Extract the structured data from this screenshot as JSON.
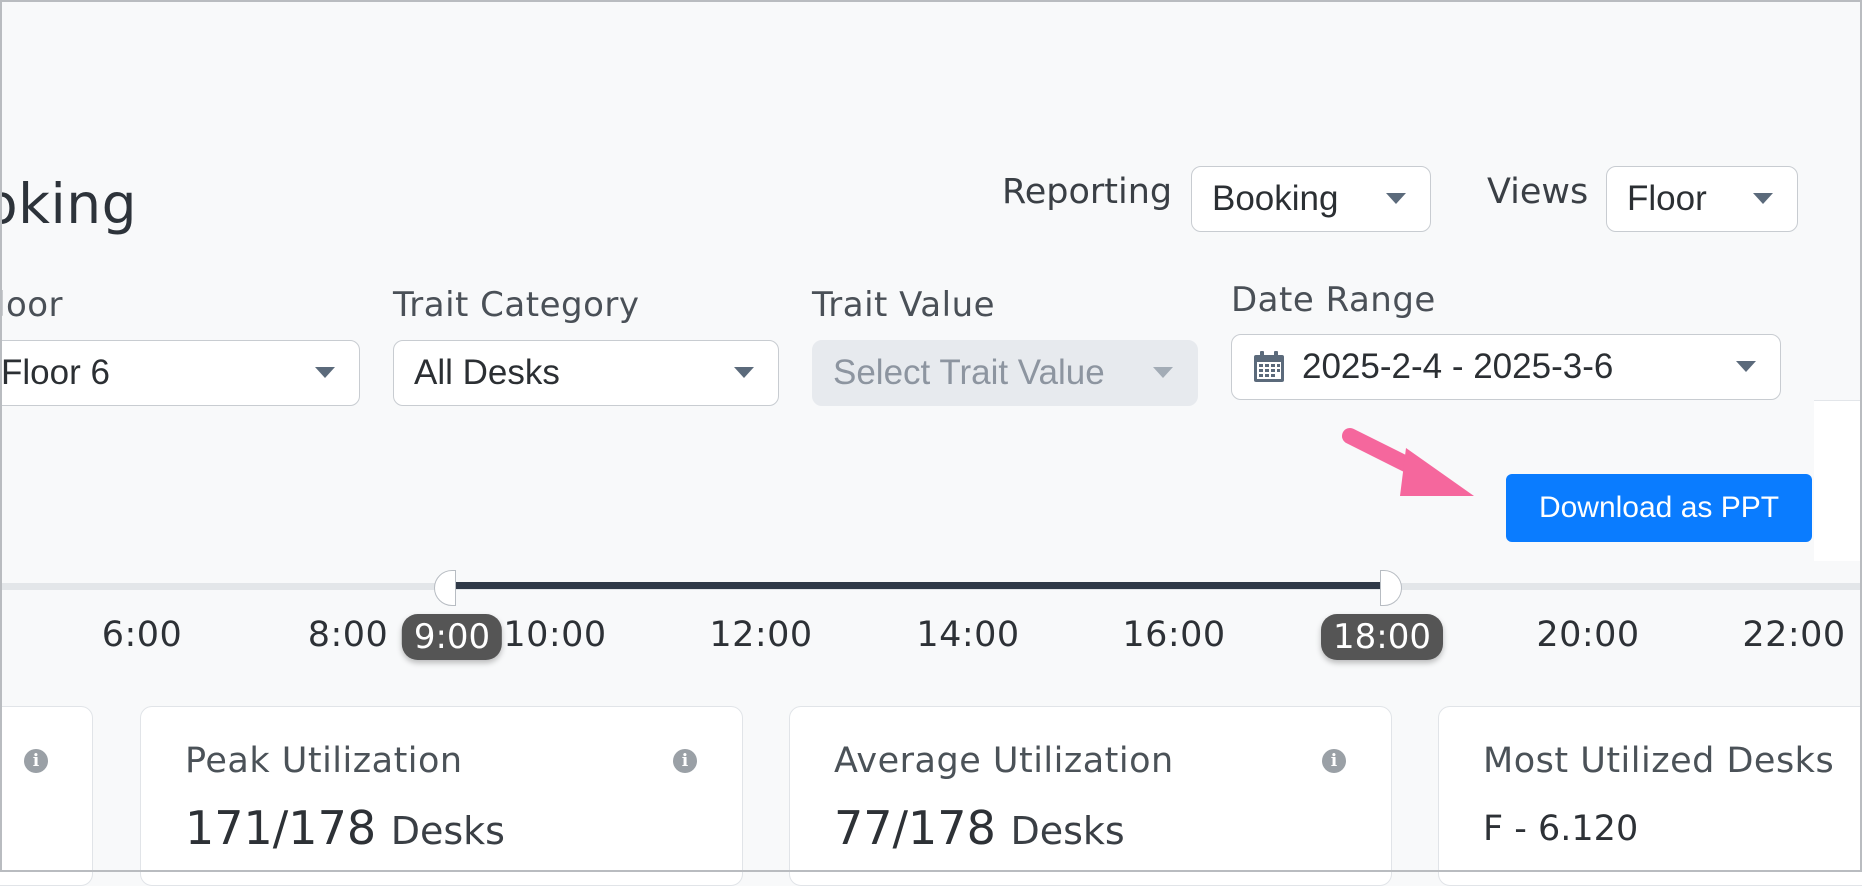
{
  "header": {
    "title": "oking",
    "reporting_label": "Reporting",
    "reporting_value": "Booking",
    "views_label": "Views",
    "views_value": "Floor"
  },
  "filters": {
    "floor": {
      "label": "loor",
      "value": "Floor 6"
    },
    "trait_category": {
      "label": "Trait Category",
      "value": "All Desks"
    },
    "trait_value": {
      "label": "Trait Value",
      "placeholder": "Select Trait Value",
      "disabled": true
    },
    "date_range": {
      "label": "Date Range",
      "value": "2025-2-4 - 2025-3-6",
      "icon": "calendar-icon"
    }
  },
  "actions": {
    "download_label": "Download as PPT",
    "download_color": "#0a7cff",
    "annotation_color": "#f5679d"
  },
  "time_slider": {
    "ticks": [
      "6:00",
      "8:00",
      "10:00",
      "12:00",
      "14:00",
      "16:00",
      "20:00",
      "22:00"
    ],
    "start": "9:00",
    "end": "18:00",
    "range_color": "#2f3947"
  },
  "cards": [
    {
      "title": "Peak Utilization",
      "value": "171/178",
      "unit": "Desks"
    },
    {
      "title": "Average Utilization",
      "value": "77/178",
      "unit": "Desks"
    },
    {
      "title": "Most Utilized Desks",
      "text": "F - 6.120"
    }
  ]
}
